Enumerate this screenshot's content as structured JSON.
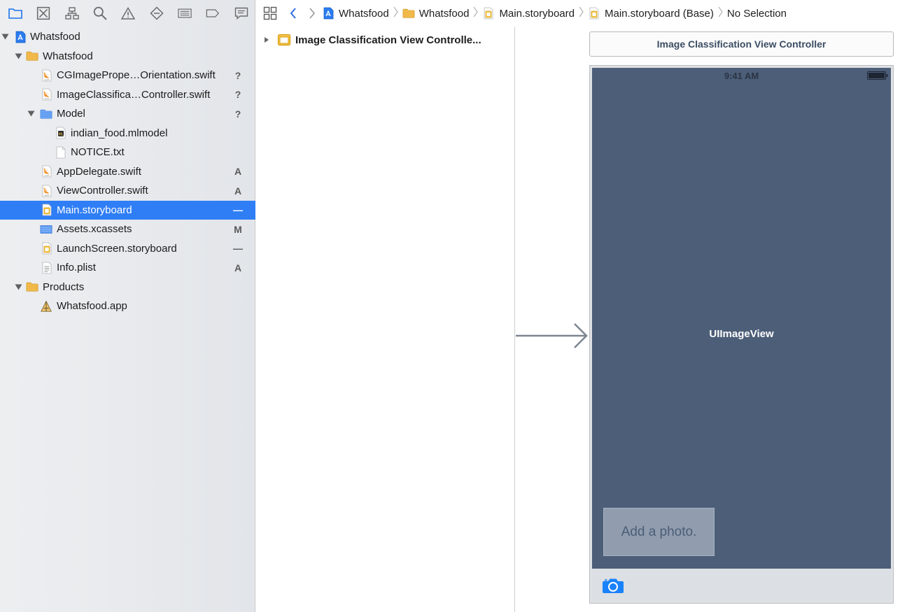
{
  "navigator": {
    "toolbar": [
      {
        "name": "project-navigator-icon",
        "active": true
      },
      {
        "name": "source-control-navigator-icon"
      },
      {
        "name": "symbol-navigator-icon"
      },
      {
        "name": "find-navigator-icon"
      },
      {
        "name": "issue-navigator-icon"
      },
      {
        "name": "test-navigator-icon"
      },
      {
        "name": "debug-navigator-icon"
      },
      {
        "name": "breakpoint-navigator-icon"
      },
      {
        "name": "report-navigator-icon"
      }
    ],
    "tree": [
      {
        "label": "Whatsfood",
        "icon": "project",
        "level": 0,
        "disclosure": "open",
        "status": ""
      },
      {
        "label": "Whatsfood",
        "icon": "folder",
        "level": 1,
        "disclosure": "open",
        "status": ""
      },
      {
        "label": "CGImagePrope…Orientation.swift",
        "icon": "swift",
        "level": 2,
        "status": "?"
      },
      {
        "label": "ImageClassifica…Controller.swift",
        "icon": "swift",
        "level": 2,
        "status": "?"
      },
      {
        "label": "Model",
        "icon": "group",
        "level": 2,
        "disclosure": "open",
        "status": "?"
      },
      {
        "label": "indian_food.mlmodel",
        "icon": "mlmodel",
        "level": 3,
        "status": ""
      },
      {
        "label": "NOTICE.txt",
        "icon": "text",
        "level": 3,
        "status": ""
      },
      {
        "label": "AppDelegate.swift",
        "icon": "swift",
        "level": 2,
        "status": "A"
      },
      {
        "label": "ViewController.swift",
        "icon": "swift",
        "level": 2,
        "status": "A"
      },
      {
        "label": "Main.storyboard",
        "icon": "storyboard",
        "level": 2,
        "status": "—",
        "selected": true
      },
      {
        "label": "Assets.xcassets",
        "icon": "assets",
        "level": 2,
        "status": "M"
      },
      {
        "label": "LaunchScreen.storyboard",
        "icon": "storyboard",
        "level": 2,
        "status": "—"
      },
      {
        "label": "Info.plist",
        "icon": "plist",
        "level": 2,
        "status": "A"
      },
      {
        "label": "Products",
        "icon": "folder",
        "level": 1,
        "disclosure": "open",
        "status": ""
      },
      {
        "label": "Whatsfood.app",
        "icon": "app",
        "level": 2,
        "status": ""
      }
    ]
  },
  "jumpbar": {
    "crumbs": [
      {
        "label": "Whatsfood",
        "icon": "project"
      },
      {
        "label": "Whatsfood",
        "icon": "folder"
      },
      {
        "label": "Main.storyboard",
        "icon": "storyboard"
      },
      {
        "label": "Main.storyboard (Base)",
        "icon": "storyboard"
      },
      {
        "label": "No Selection",
        "icon": ""
      }
    ]
  },
  "outline": {
    "scene_label": "Image Classification View Controlle..."
  },
  "canvas": {
    "scene_title": "Image Classification View Controller",
    "status_time": "9:41 AM",
    "image_view_label": "UIImageView",
    "photo_label": "Add a photo."
  },
  "colors": {
    "selection": "#2f7ef6",
    "device_view": "#4c5e78",
    "photo_label_bg": "#919daf",
    "accent_blue": "#1a82fb"
  }
}
